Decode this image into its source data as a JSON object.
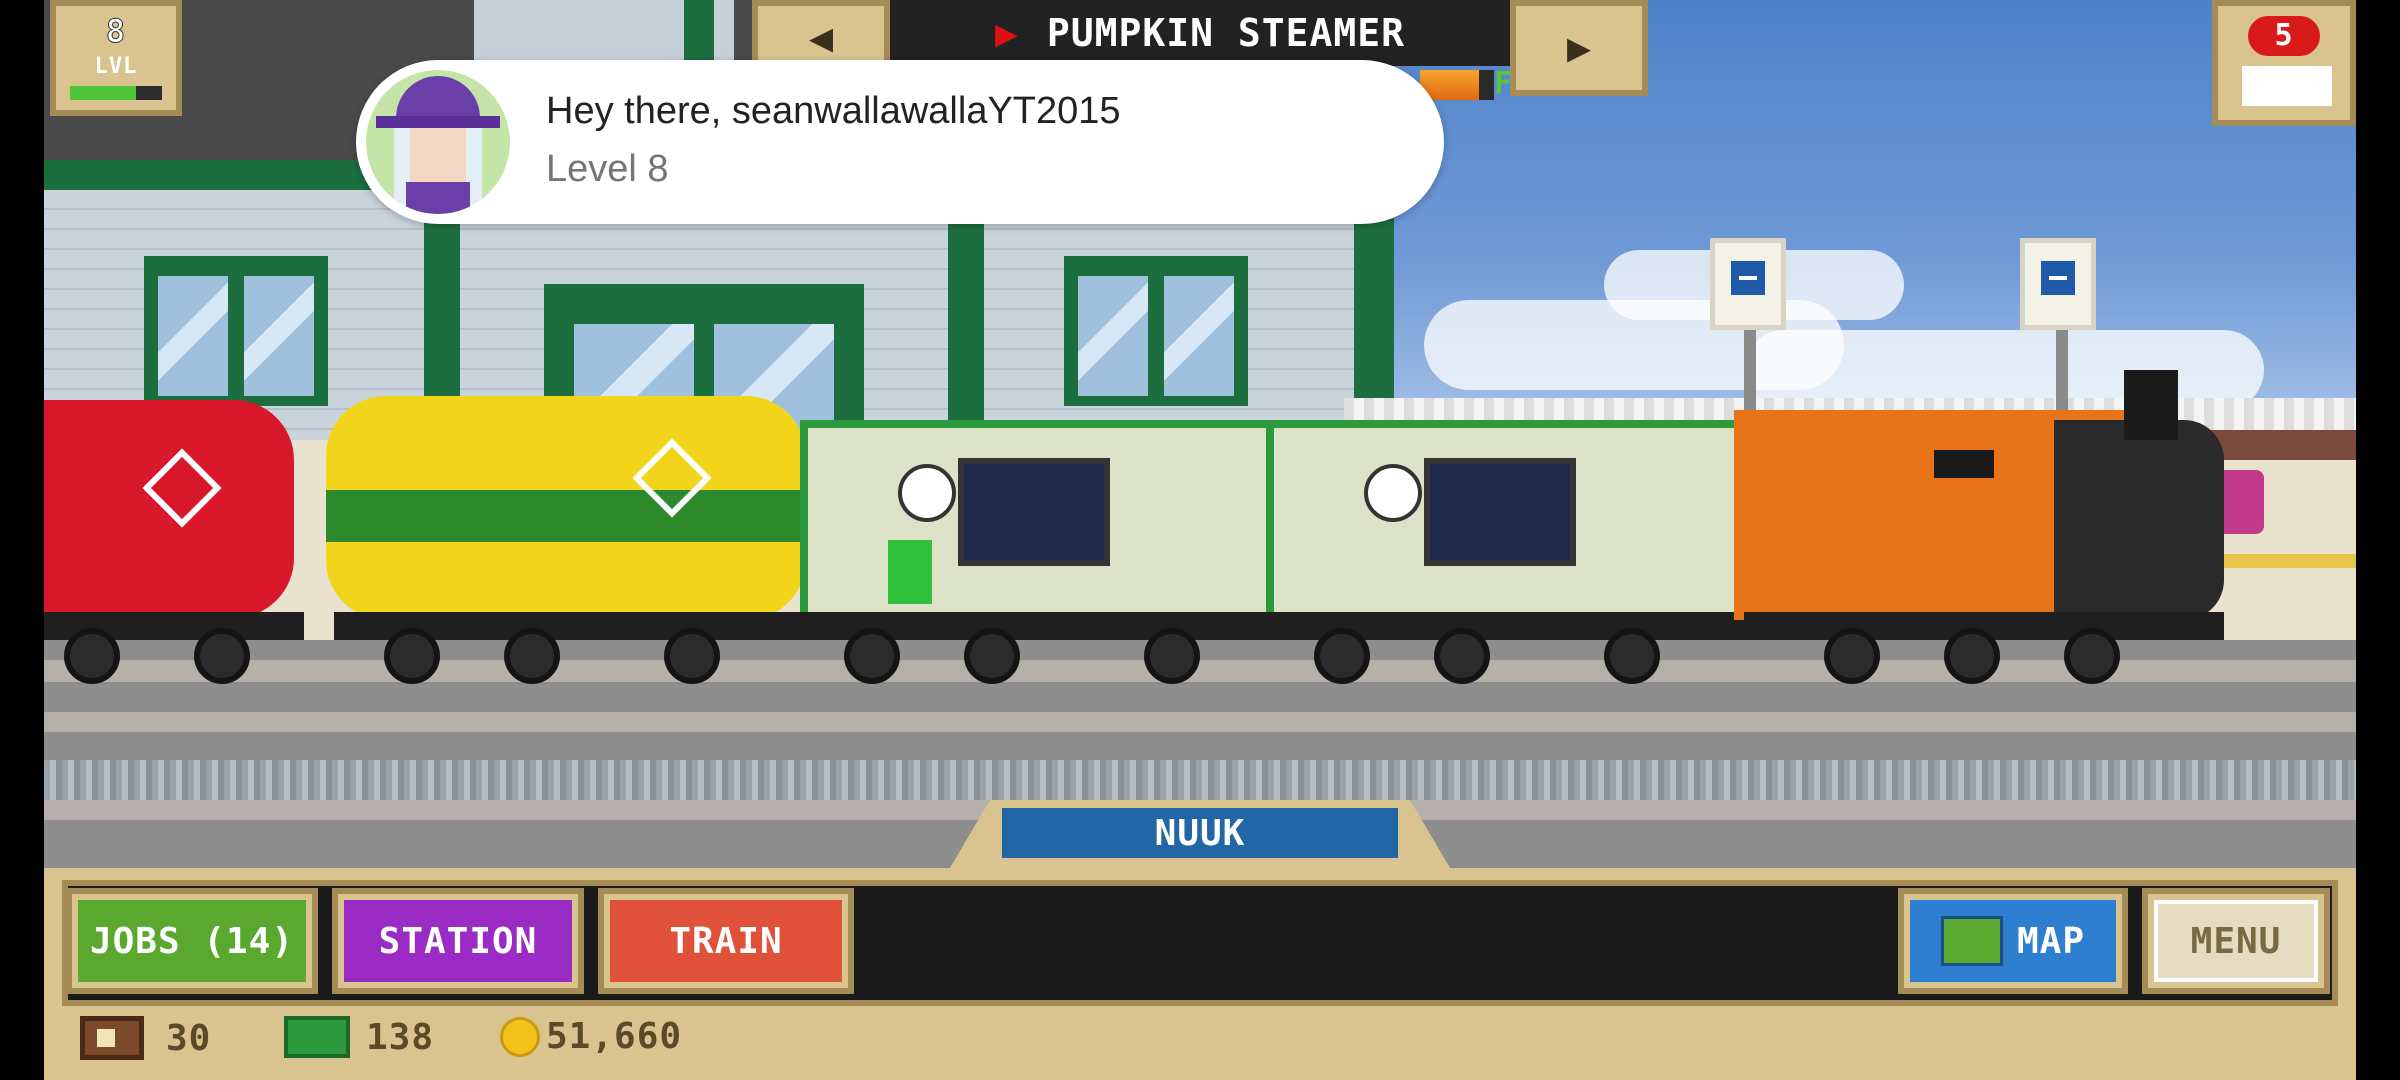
{
  "hud": {
    "level_value": "8",
    "level_label": "LVL",
    "train_name": "PUMPKIN STEAMER",
    "fuel_label": "F",
    "badge_count": "5"
  },
  "notification": {
    "greeting": "Hey there, seanwallawallaYT2015",
    "level_text": "Level 8"
  },
  "station": {
    "name": "NUUK"
  },
  "buttons": {
    "jobs": "JOBS (14)",
    "station": "STATION",
    "train": "TRAIN",
    "map": "MAP",
    "menu": "MENU"
  },
  "resources": {
    "crates": "30",
    "cash": "138",
    "coins": "51,660"
  },
  "colors": {
    "jobs_button": "#5aa92e",
    "station_button": "#9a2bc4",
    "train_button": "#e0513a",
    "map_button": "#2f7fd1",
    "menu_button": "#e6dcc2",
    "station_label": "#2266a6",
    "hud_frame": "#d9c48f"
  }
}
